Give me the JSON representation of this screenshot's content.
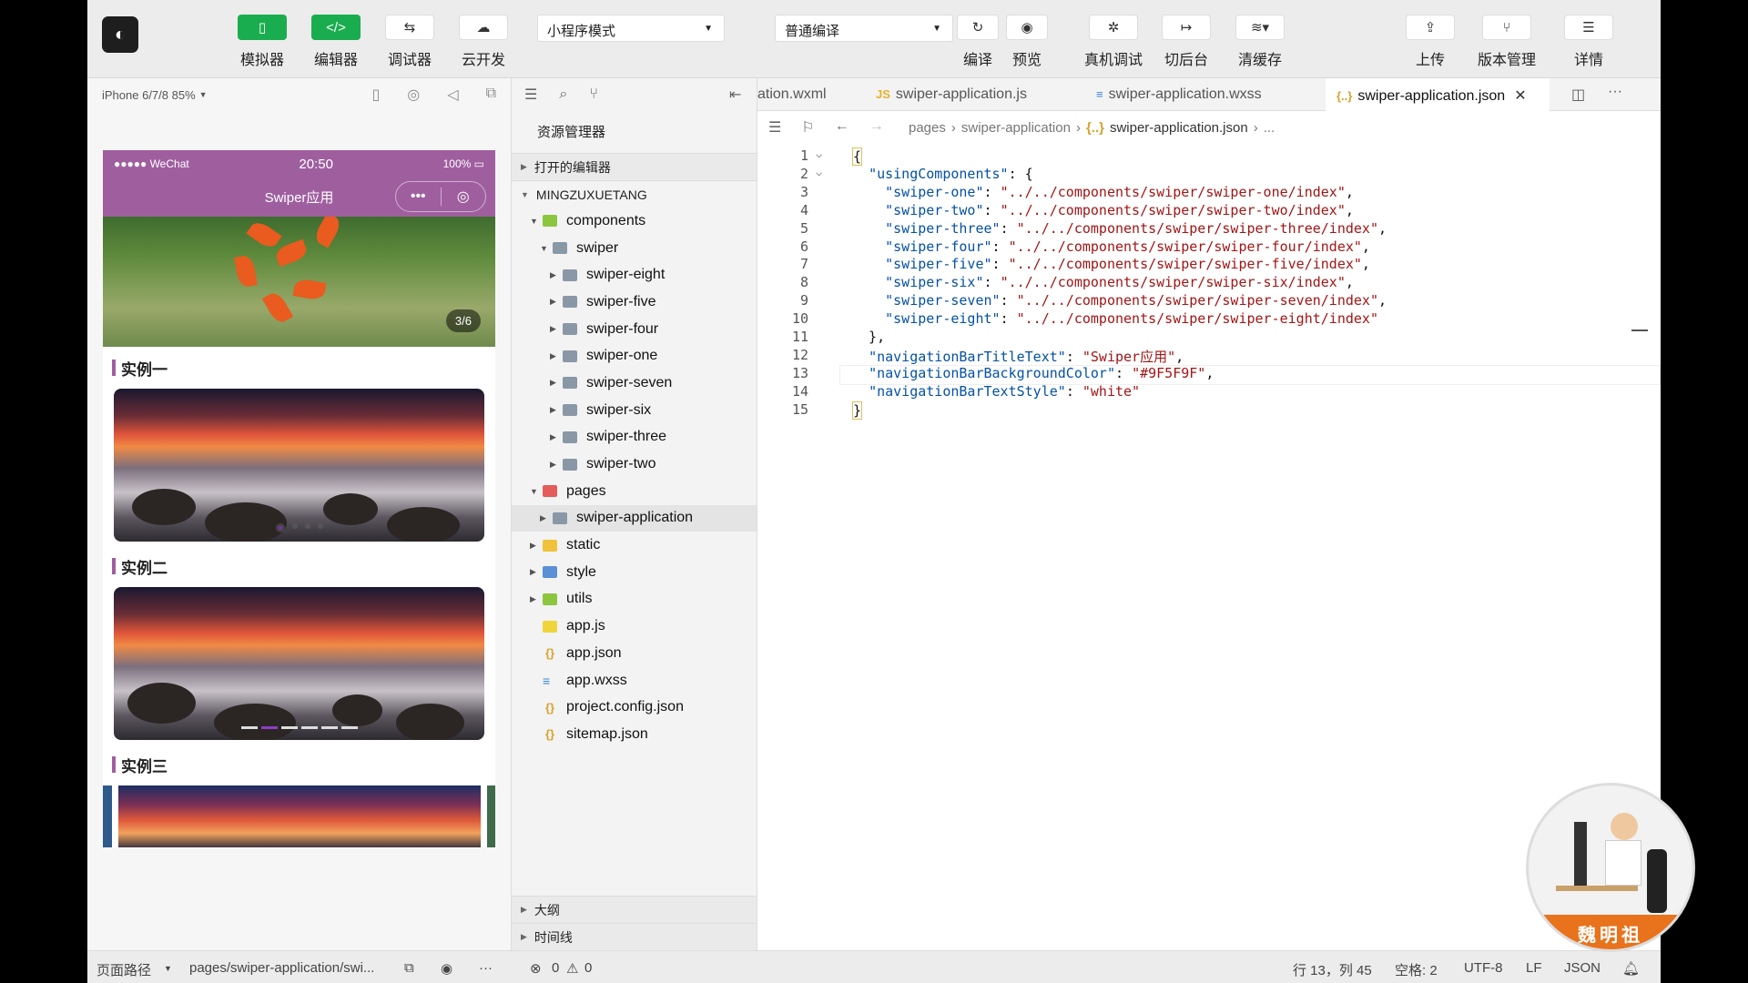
{
  "toolbar": {
    "simulator": "模拟器",
    "editor": "编辑器",
    "debugger": "调试器",
    "cloud": "云开发",
    "mode": "小程序模式",
    "compile_mode": "普通编译",
    "compile": "编译",
    "preview": "预览",
    "remote_debug": "真机调试",
    "background": "切后台",
    "clear_cache": "清缓存",
    "upload": "上传",
    "version": "版本管理",
    "details": "详情"
  },
  "simulator": {
    "device": "iPhone 6/7/8 85%",
    "status_carrier": "●●●●● WeChat",
    "status_time": "20:50",
    "status_battery": "100%",
    "nav_title": "Swiper应用",
    "counter": "3/6",
    "sections": [
      "实例一",
      "实例二",
      "实例三"
    ]
  },
  "explorer": {
    "title": "资源管理器",
    "open_editors": "打开的编辑器",
    "project": "MINGZUXUETANG",
    "tree": [
      {
        "name": "components",
        "depth": 0,
        "type": "folder-green",
        "open": true
      },
      {
        "name": "swiper",
        "depth": 1,
        "type": "folder",
        "open": true
      },
      {
        "name": "swiper-eight",
        "depth": 2,
        "type": "folder"
      },
      {
        "name": "swiper-five",
        "depth": 2,
        "type": "folder"
      },
      {
        "name": "swiper-four",
        "depth": 2,
        "type": "folder"
      },
      {
        "name": "swiper-one",
        "depth": 2,
        "type": "folder"
      },
      {
        "name": "swiper-seven",
        "depth": 2,
        "type": "folder"
      },
      {
        "name": "swiper-six",
        "depth": 2,
        "type": "folder"
      },
      {
        "name": "swiper-three",
        "depth": 2,
        "type": "folder"
      },
      {
        "name": "swiper-two",
        "depth": 2,
        "type": "folder"
      },
      {
        "name": "pages",
        "depth": 0,
        "type": "folder-red",
        "open": true
      },
      {
        "name": "swiper-application",
        "depth": 1,
        "type": "folder",
        "selected": true
      },
      {
        "name": "static",
        "depth": 0,
        "type": "folder-yellow"
      },
      {
        "name": "style",
        "depth": 0,
        "type": "folder-blue"
      },
      {
        "name": "utils",
        "depth": 0,
        "type": "folder-green"
      },
      {
        "name": "app.js",
        "depth": 0,
        "type": "js"
      },
      {
        "name": "app.json",
        "depth": 0,
        "type": "json"
      },
      {
        "name": "app.wxss",
        "depth": 0,
        "type": "wxss"
      },
      {
        "name": "project.config.json",
        "depth": 0,
        "type": "json"
      },
      {
        "name": "sitemap.json",
        "depth": 0,
        "type": "json"
      }
    ],
    "outline": "大纲",
    "timeline": "时间线"
  },
  "tabs": [
    {
      "label": "ation.wxml",
      "icon": ""
    },
    {
      "label": "swiper-application.js",
      "icon": "JS"
    },
    {
      "label": "swiper-application.wxss",
      "icon": "≡"
    },
    {
      "label": "swiper-application.json",
      "icon": "{..}",
      "active": true
    }
  ],
  "breadcrumb": {
    "part1": "pages",
    "part2": "swiper-application",
    "file": "swiper-application.json",
    "more": "..."
  },
  "code": [
    "{",
    "  \"usingComponents\": {",
    "    \"swiper-one\": \"../../components/swiper/swiper-one/index\",",
    "    \"swiper-two\": \"../../components/swiper/swiper-two/index\",",
    "    \"swiper-three\": \"../../components/swiper/swiper-three/index\",",
    "    \"swiper-four\": \"../../components/swiper/swiper-four/index\",",
    "    \"swiper-five\": \"../../components/swiper/swiper-five/index\",",
    "    \"swiper-six\": \"../../components/swiper/swiper-six/index\",",
    "    \"swiper-seven\": \"../../components/swiper/swiper-seven/index\",",
    "    \"swiper-eight\": \"../../components/swiper/swiper-eight/index\"",
    "  },",
    "  \"navigationBarTitleText\": \"Swiper应用\",",
    "  \"navigationBarBackgroundColor\": \"#9F5F9F\",",
    "  \"navigationBarTextStyle\": \"white\"",
    "}"
  ],
  "statusbar": {
    "page_path_label": "页面路径",
    "page_path": "pages/swiper-application/swi...",
    "errors": "0",
    "warnings": "0",
    "position": "行 13，列 45",
    "spaces": "空格: 2",
    "encoding": "UTF-8",
    "eol": "LF",
    "language": "JSON"
  },
  "avatar": {
    "name": "魏明祖"
  },
  "colors": {
    "nav": "#9F5F9F",
    "accent": "#1AAD4F"
  }
}
